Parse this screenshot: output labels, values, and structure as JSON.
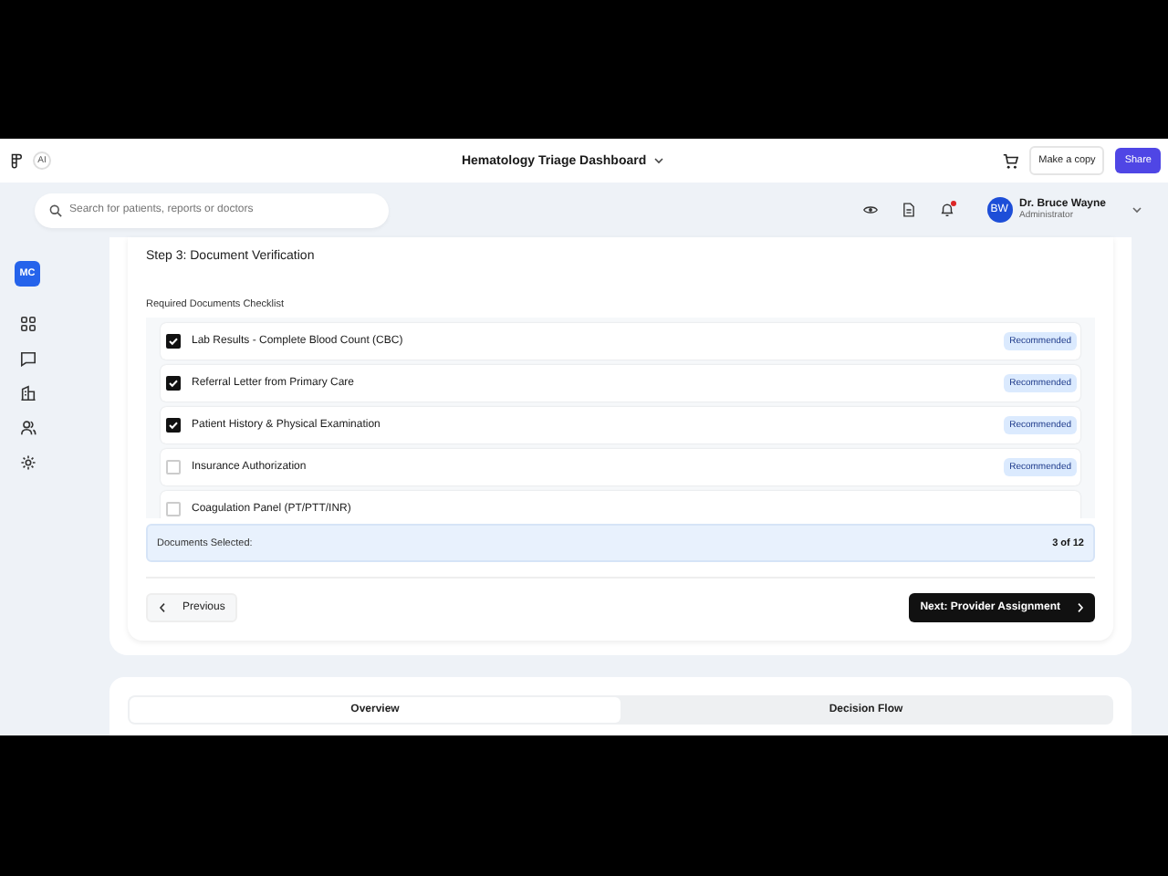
{
  "topbar": {
    "badge": "AI",
    "title": "Hematology Triage Dashboard",
    "copy_button": "Make a copy",
    "share_button": "Share"
  },
  "sidebar": {
    "logo": "MC"
  },
  "header": {
    "search": {
      "placeholder": "Search for patients, reports or doctors"
    },
    "notification_unread": true,
    "user": {
      "initials": "BW",
      "name": "Dr. Bruce Wayne",
      "role": "Administrator"
    }
  },
  "step": {
    "title": "Step 3: Document Verification",
    "checklist_label": "Required Documents Checklist",
    "documents": [
      {
        "label": "Lab Results - Complete Blood Count (CBC)",
        "checked": true,
        "tag": "Recommended"
      },
      {
        "label": "Referral Letter from Primary Care",
        "checked": true,
        "tag": "Recommended"
      },
      {
        "label": "Patient History & Physical Examination",
        "checked": true,
        "tag": "Recommended"
      },
      {
        "label": "Insurance Authorization",
        "checked": false,
        "tag": "Recommended"
      },
      {
        "label": "Coagulation Panel (PT/PTT/INR)",
        "checked": false
      }
    ],
    "summary_label": "Documents Selected:",
    "summary_value": "3 of 12",
    "previous_button": "Previous",
    "next_button": "Next: Provider Assignment"
  },
  "tabs": [
    {
      "label": "Overview",
      "selected": true
    },
    {
      "label": "Decision Flow",
      "selected": false
    }
  ]
}
